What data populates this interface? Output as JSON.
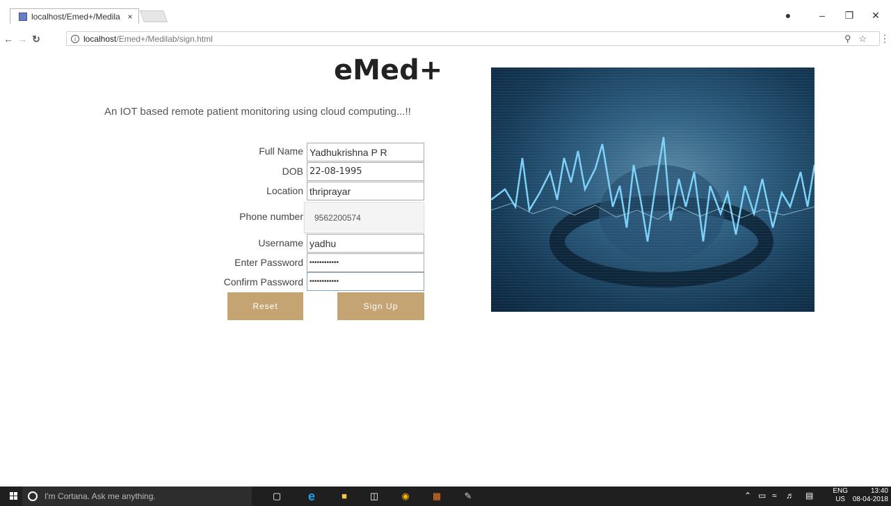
{
  "browser": {
    "tab_title": "localhost/Emed+/Medila",
    "tab_close": "×",
    "url_host": "localhost",
    "url_path": "/Emed+/Medilab/sign.html",
    "info_glyph": "i",
    "key_icon": "key-icon",
    "star_icon": "bookmark-star-icon"
  },
  "page": {
    "brand": "eMed+",
    "tagline": "An IOT based remote patient monitoring using cloud computing...!!"
  },
  "form": {
    "full_name_label": "Full Name",
    "full_name_value": "Yadhukrishna P R",
    "dob_label": "DOB",
    "dob_value": "22-08-1995",
    "location_label": "Location",
    "location_value": "thriprayar",
    "phone_label": "Phone number",
    "phone_autofill": "9562200574",
    "username_label": "Username",
    "username_value": "yadhu",
    "password_label": "Enter Password",
    "password_value": "••••••••••••",
    "confirm_label": "Confirm Password",
    "confirm_value": "••••••••••••",
    "reset_label": "Reset",
    "signup_label": "Sign Up"
  },
  "taskbar": {
    "cortana_text": "I'm Cortana. Ask me anything.",
    "lang_top": "ENG",
    "lang_bottom": "US",
    "time": "13:40",
    "date": "08-04-2018"
  },
  "colors": {
    "button": "#c3a472",
    "taskbar": "#1f1f1f"
  }
}
